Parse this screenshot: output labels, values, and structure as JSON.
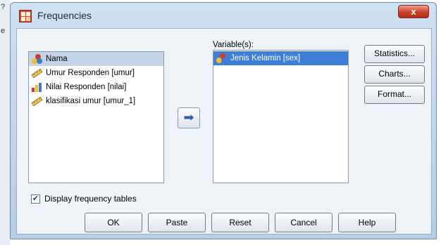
{
  "background": {
    "fragments": [
      "e",
      "?"
    ]
  },
  "window": {
    "title": "Frequencies",
    "close_label": "x"
  },
  "source_list": {
    "items": [
      {
        "label": "Nama",
        "icon": "nominal-variable-icon",
        "selected": true
      },
      {
        "label": "Umur Responden [umur]",
        "icon": "scale-ruler-icon",
        "selected": false
      },
      {
        "label": "Nilai Responden [nilai]",
        "icon": "ordinal-bar-icon",
        "selected": false
      },
      {
        "label": "klasifikasi umur [umur_1]",
        "icon": "scale-ruler-icon",
        "selected": false
      }
    ]
  },
  "target_list": {
    "label": "Variable(s):",
    "items": [
      {
        "label": "Jenis Kelamin [sex]",
        "icon": "nominal-variable-icon",
        "selected": true
      }
    ]
  },
  "move_button": {
    "glyph": "➡"
  },
  "side_buttons": {
    "statistics": "Statistics...",
    "charts": "Charts...",
    "format": "Format..."
  },
  "display_frequency_tables": {
    "label": "Display frequency tables",
    "checked": true,
    "mark": "✔"
  },
  "bottom_buttons": {
    "ok": "OK",
    "paste": "Paste",
    "reset": "Reset",
    "cancel": "Cancel",
    "help": "Help"
  },
  "colors": {
    "accent": "#3d7fd6",
    "close_red": "#c9412a"
  }
}
